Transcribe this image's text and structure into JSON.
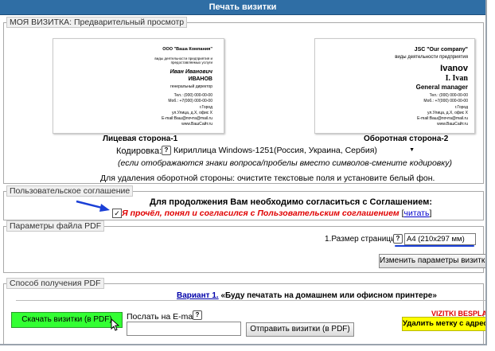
{
  "header": {
    "title": "Печать визитки"
  },
  "preview": {
    "legend": "МОЯ ВИЗИТКА: Предварительный просмотр",
    "front": {
      "company": "ООО \"Ваша Компания\"",
      "activity": "виды деятельности предприятия и предоставляемых услуги",
      "first_name": "Иван Иванович",
      "last_name": "ИВАНОВ",
      "position": "генеральный директор",
      "phone": "Тел.: (000) 000-00-00",
      "mobile": "Моб.: +7(000) 000-00-00",
      "city": "г.Город",
      "address": "ул.Улица, д.X, офис X",
      "email": "E-mail:Ваш@почта@mail.ru",
      "site": "www.ВашСайт.ru",
      "caption": "Лицевая сторона-1"
    },
    "back": {
      "company": "JSC \"Our company\"",
      "activity": "виды деятельности предприятия",
      "last_name": "Ivanov",
      "first_name": "I. Ivan",
      "position": "General manager",
      "phone": "Тел.: (000) 000-00-00",
      "mobile": "Моб.: +7(000) 000-00-00",
      "city": "г.Город",
      "address": "ул.Улица, д.X, офис X",
      "email": "E-mail:Ваш@почта@mail.ru",
      "site": "www.ВашСайт.ru",
      "caption": "Оборотная сторона-2"
    },
    "encoding_label": "Кодировка:",
    "encoding_value": "Кириллица Windows-1251(Россия, Украина, Сербия)",
    "encoding_hint": "(если отображаются знаки вопроса/пробелы вместо символов-смените кодировку)",
    "back_remove_hint": "Для удаления оборотной стороны: очистите текстовые поля и установите белый фон."
  },
  "agreement": {
    "legend": "Пользовательское соглашение",
    "heading": "Для продолжения Вам необходимо согласиться с Соглашением:",
    "checkbox_label": "Я прочёл, понял и согласился с Пользовательским соглашением",
    "read_link": "читать",
    "bracket_open": "[",
    "bracket_close": "]"
  },
  "pdf": {
    "legend": "Параметры файла PDF",
    "page_size_label": "1.Размер страницы:",
    "page_size_value": "A4 (210x297 мм)",
    "change_button": "Изменить параметры визитки"
  },
  "delivery": {
    "legend": "Способ получения PDF",
    "variant_label": "Вариант 1.",
    "variant_text": "«Буду печатать на домашнем или офисном принтере»",
    "download_button": "Скачать визитки (в PDF)",
    "email_label": "Послать на E-mail:",
    "email_value": "",
    "send_button": "Отправить визитки (в PDF)",
    "promo_text": "VIZITKI BESPLATNO",
    "remove_label_button": "Удалить метку с адреса"
  },
  "help_glyph": "?",
  "colors": {
    "title_bar": "#2f6ea5",
    "download_green": "#33ff33",
    "remove_yellow": "#ffff00",
    "agreement_red": "#e00000",
    "link_blue": "#0000cc"
  }
}
